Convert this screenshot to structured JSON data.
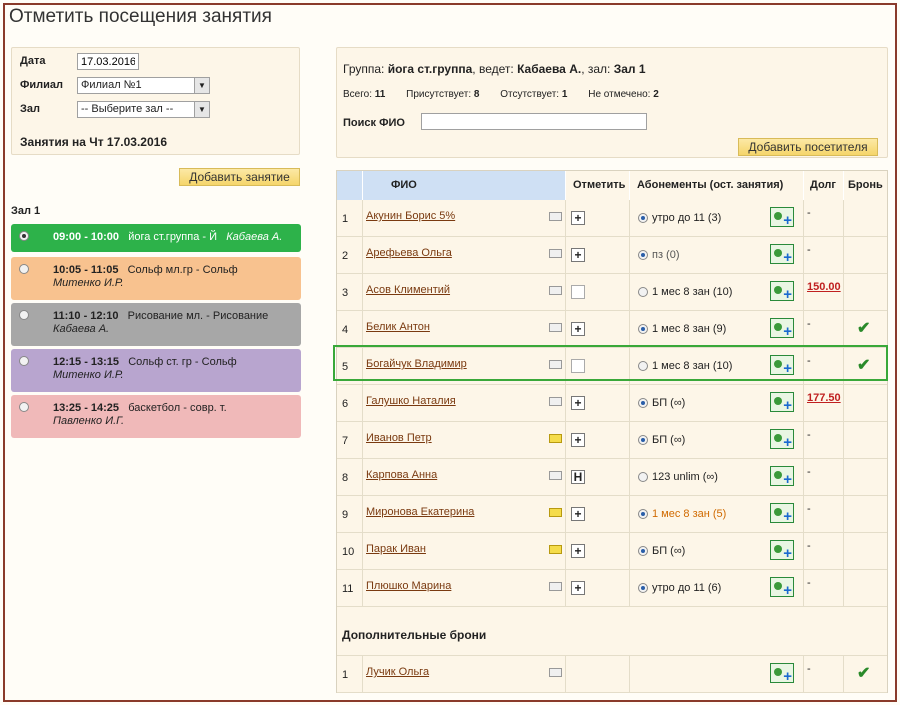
{
  "page_title": "Отметить посещения занятия",
  "filter": {
    "date_label": "Дата",
    "date_value": "17.03.2016",
    "branch_label": "Филиал",
    "branch_value": "Филиал №1",
    "hall_label": "Зал",
    "hall_value": "-- Выберите зал --",
    "lessons_title": "Занятия на Чт 17.03.2016"
  },
  "add_lesson_button": "Добавить занятие",
  "hall_name": "Зал 1",
  "lessons": [
    {
      "time": "09:00 - 10:00",
      "title": "йога ст.группа - Й",
      "teacher": "Кабаева А.",
      "bg": "#2db24a",
      "color": "#ffffff",
      "selected": true
    },
    {
      "time": "10:05 - 11:05",
      "title": "Сольф мл.гр - Сольф",
      "teacher": "Митенко И.Р.",
      "bg": "#f8c28f",
      "color": "#222222",
      "selected": false
    },
    {
      "time": "11:10 - 12:10",
      "title": "Рисование мл. - Рисование",
      "teacher": "Кабаева А.",
      "bg": "#a7a7a7",
      "color": "#222222",
      "selected": false
    },
    {
      "time": "12:15 - 13:15",
      "title": "Сольф ст. гр - Сольф",
      "teacher": "Митенко И.Р.",
      "bg": "#b8a5cf",
      "color": "#222222",
      "selected": false
    },
    {
      "time": "13:25 - 14:25",
      "title": "баскетбол - совр. т.",
      "teacher": "Павленко И.Г.",
      "bg": "#f0b9b9",
      "color": "#222222",
      "selected": false
    }
  ],
  "group": {
    "group_label": "Группа:",
    "group_value": "йога ст.группа",
    "teacher_label": ", ведет:",
    "teacher_value": "Кабаева А.",
    "hall_label": ", зал:",
    "hall_value": "Зал 1"
  },
  "stats": {
    "total_label": "Всего:",
    "total": "11",
    "present_label": "Присутствует:",
    "present": "8",
    "absent_label": "Отсутствует:",
    "absent": "1",
    "unmarked_label": "Не отмечено:",
    "unmarked": "2"
  },
  "search": {
    "label": "Поиск ФИО",
    "value": ""
  },
  "add_visitor_button": "Добавить посетителя",
  "table": {
    "headers": {
      "name": "ФИО",
      "mark": "Отметить",
      "subs": "Абонементы (ост. занятия)",
      "debt": "Долг",
      "bron": "Бронь"
    },
    "rows": [
      {
        "n": "1",
        "name": "Акунин Борис 5%",
        "note_yellow": false,
        "mark": "+",
        "radio_on": true,
        "sub": "утро до 11 (3)",
        "sub_color": "#222222",
        "debt": "-",
        "debt_link": false,
        "bron": ""
      },
      {
        "n": "2",
        "name": "Арефьева Ольга",
        "note_yellow": false,
        "mark": "+",
        "radio_on": true,
        "sub": "пз (0)",
        "sub_color": "#555555",
        "debt": "-",
        "debt_link": false,
        "bron": ""
      },
      {
        "n": "3",
        "name": "Асов Климентий",
        "note_yellow": false,
        "mark": "",
        "radio_on": false,
        "sub": "1 мес 8 зан (10)",
        "sub_color": "#222222",
        "debt": "150.00",
        "debt_link": true,
        "bron": ""
      },
      {
        "n": "4",
        "name": "Белик Антон",
        "note_yellow": false,
        "mark": "+",
        "radio_on": true,
        "sub": "1 мес 8 зан (9)",
        "sub_color": "#222222",
        "debt": "-",
        "debt_link": false,
        "bron": "✔"
      },
      {
        "n": "5",
        "name": "Богайчук Владимир",
        "note_yellow": false,
        "mark": "",
        "radio_on": false,
        "sub": "1 мес 8 зан (10)",
        "sub_color": "#222222",
        "debt": "-",
        "debt_link": false,
        "bron": "✔"
      },
      {
        "n": "6",
        "name": "Галушко Наталия",
        "note_yellow": false,
        "mark": "+",
        "radio_on": true,
        "sub": "БП (∞)",
        "sub_color": "#222222",
        "debt": "177.50",
        "debt_link": true,
        "bron": ""
      },
      {
        "n": "7",
        "name": "Иванов Петр",
        "note_yellow": true,
        "mark": "+",
        "radio_on": true,
        "sub": "БП (∞)",
        "sub_color": "#222222",
        "debt": "-",
        "debt_link": false,
        "bron": ""
      },
      {
        "n": "8",
        "name": "Карпова Анна",
        "note_yellow": false,
        "mark": "Н",
        "radio_on": false,
        "sub": "123 unlim (∞)",
        "sub_color": "#222222",
        "debt": "-",
        "debt_link": false,
        "bron": ""
      },
      {
        "n": "9",
        "name": "Миронова Екатерина",
        "note_yellow": true,
        "mark": "+",
        "radio_on": true,
        "sub": "1 мес 8 зан (5)",
        "sub_color": "#d06a00",
        "debt": "-",
        "debt_link": false,
        "bron": ""
      },
      {
        "n": "10",
        "name": "Парак Иван",
        "note_yellow": true,
        "mark": "+",
        "radio_on": true,
        "sub": "БП (∞)",
        "sub_color": "#222222",
        "debt": "-",
        "debt_link": false,
        "bron": ""
      },
      {
        "n": "11",
        "name": "Плюшко Марина",
        "note_yellow": false,
        "mark": "+",
        "radio_on": true,
        "sub": "утро до 11 (6)",
        "sub_color": "#222222",
        "debt": "-",
        "debt_link": false,
        "bron": ""
      }
    ],
    "extra_title": "Дополнительные брони",
    "extra_rows": [
      {
        "n": "1",
        "name": "Лучик Ольга",
        "debt": "-",
        "bron": "✔"
      }
    ]
  }
}
